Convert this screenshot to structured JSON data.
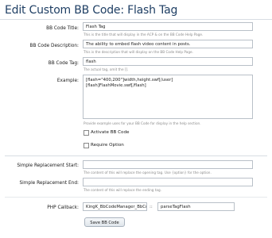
{
  "page": {
    "title": "Edit Custom BB Code: Flash Tag"
  },
  "fields": {
    "title": {
      "label": "BB Code Title:",
      "value": "Flash Tag",
      "hint": "This is the title that will display in the ACP & on the BB Code Help Page."
    },
    "description": {
      "label": "BB Code Description:",
      "value": "The ability to embed flash video content in posts.",
      "hint": "This is the description that will display on the BB Code Help Page."
    },
    "tag": {
      "label": "BB Code Tag:",
      "value": "flash",
      "hint": "The actual tag, omit the []."
    },
    "example": {
      "label": "Example:",
      "value": "[flash=\"400,200\"]width,height.swf[/user]\n[flash]FlashMovie.swf[/flash]",
      "hint": "Provide example uses for your BB Code for display in the help section."
    },
    "activate": {
      "label": "Activate BB Code",
      "checked": false
    },
    "require_option": {
      "label": "Require Option",
      "checked": false
    },
    "replacement_start": {
      "label": "Simple Replacement Start:",
      "value": "",
      "hint": "The content of this will replace the opening tag. Use {option} for the option."
    },
    "replacement_end": {
      "label": "Simple Replacement End:",
      "value": "",
      "hint": "The content of this will replace the ending tag."
    },
    "php_callback": {
      "label": "PHP Callback:",
      "class_value": "KingK_BbCodeManager_BbCode_Fo",
      "separator": "::",
      "method_value": "parseTagFlash"
    }
  },
  "actions": {
    "save_label": "Save BB Code"
  }
}
